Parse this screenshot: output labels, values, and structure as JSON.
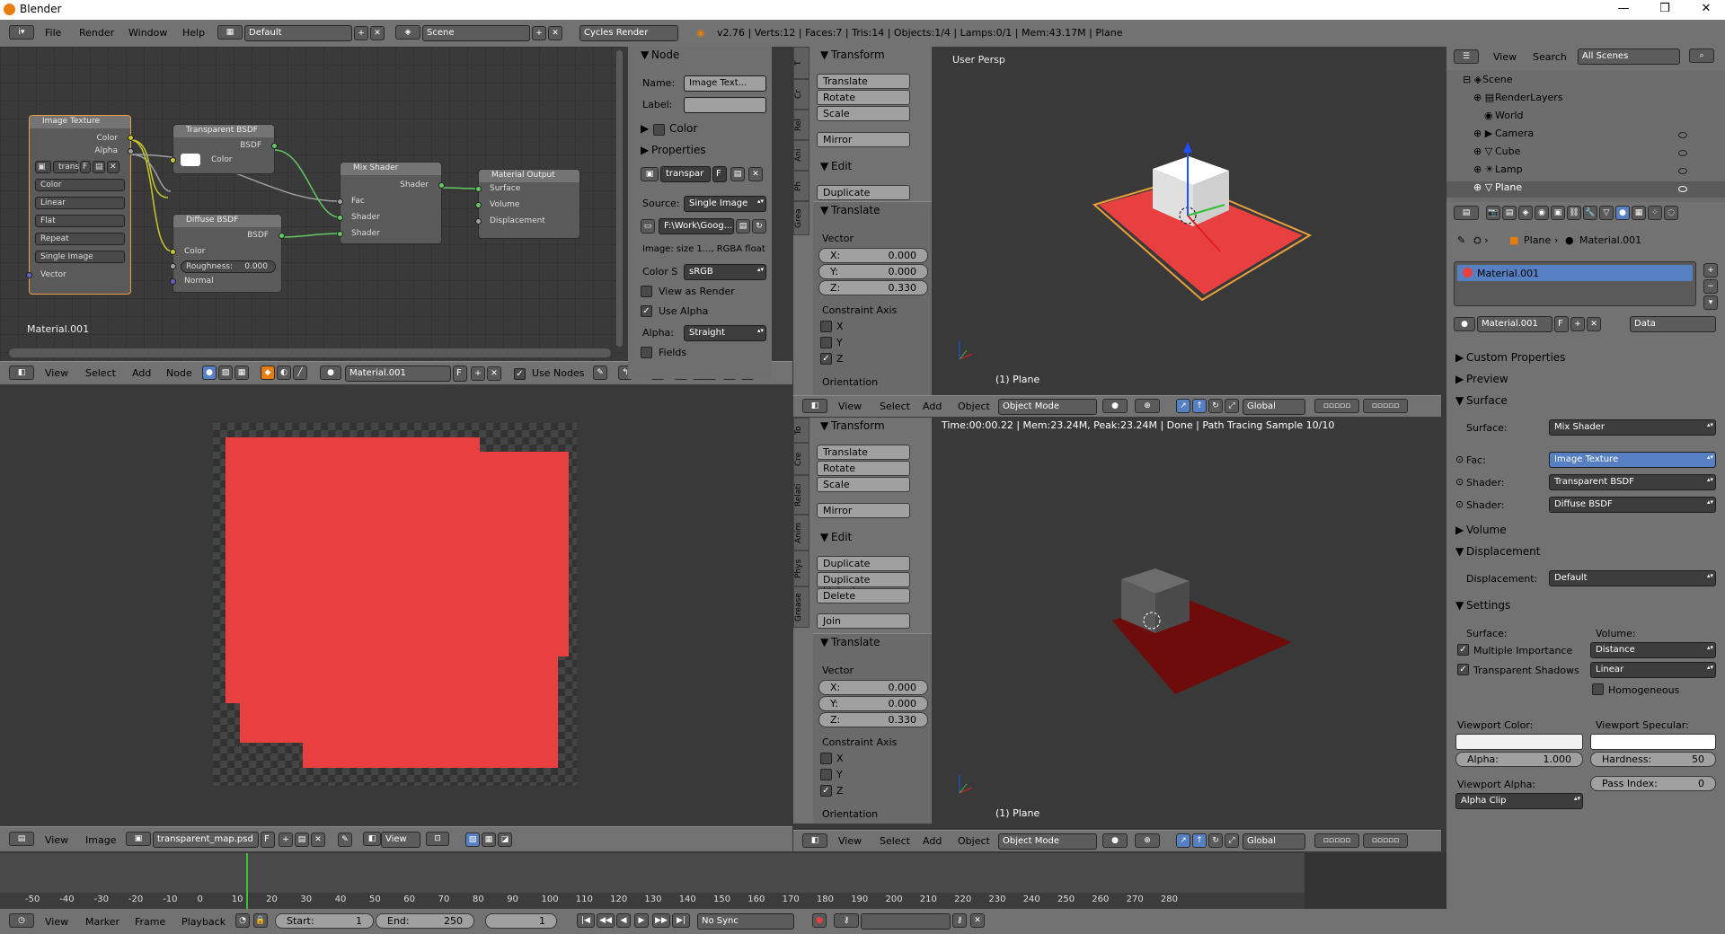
{
  "app": {
    "title": "Blender",
    "window_buttons": [
      "—",
      "❒",
      "✕"
    ]
  },
  "info_bar": {
    "menus": [
      "File",
      "Render",
      "Window",
      "Help"
    ],
    "layout": "Default",
    "scene": "Scene",
    "engine": "Cycles Render",
    "stats": "v2.76 | Verts:12 | Faces:7 | Tris:14 | Objects:1/4 | Lamps:0/1 | Mem:43.17M | Plane"
  },
  "node_editor": {
    "material_label": "Material.001",
    "nodes": {
      "image_texture": {
        "title": "Image Texture",
        "out_color": "Color",
        "out_alpha": "Alpha",
        "image": "trans",
        "image_f": "F",
        "color": "Color",
        "interp": "Linear",
        "proj": "Flat",
        "ext": "Repeat",
        "source": "Single Image",
        "vector": "Vector"
      },
      "transparent": {
        "title": "Transparent BSDF",
        "out": "BSDF",
        "color": "Color"
      },
      "diffuse": {
        "title": "Diffuse BSDF",
        "out": "BSDF",
        "color": "Color",
        "roughness": "Roughness:",
        "roughness_val": "0.000",
        "normal": "Normal"
      },
      "mix": {
        "title": "Mix Shader",
        "out": "Shader",
        "fac": "Fac",
        "shader1": "Shader",
        "shader2": "Shader"
      },
      "output": {
        "title": "Material Output",
        "surface": "Surface",
        "volume": "Volume",
        "displacement": "Displacement"
      }
    },
    "header": {
      "menus": [
        "View",
        "Select",
        "Add",
        "Node"
      ],
      "material": "Material.001",
      "f": "F",
      "use_nodes": "Use Nodes"
    }
  },
  "node_panel": {
    "node_title": "Node",
    "name_label": "Name:",
    "name_value": "Image Text...",
    "label_label": "Label:",
    "label_value": "",
    "color_title": "Color",
    "properties_title": "Properties",
    "img_name": "transpar",
    "img_f": "F",
    "source_label": "Source:",
    "source_value": "Single Image",
    "path": "F:\\Work\\Goog...",
    "image_info": "Image: size 1..., RGBA float",
    "colors_label": "Color S",
    "colors_value": "sRGB",
    "view_as_render": "View as Render",
    "use_alpha": "Use Alpha",
    "alpha_label": "Alpha:",
    "alpha_value": "Straight",
    "fields": "Fields"
  },
  "image_editor": {
    "header": {
      "menus": [
        "View",
        "Image"
      ],
      "image": "transparent_map.psd",
      "f": "F",
      "view": "View"
    }
  },
  "tools": {
    "tabs1": [
      "T",
      "Cr",
      "Rel",
      "Ani",
      "Ph",
      "Grea"
    ],
    "tabs2": [
      "To",
      "Cre",
      "Relati",
      "Anim",
      "Phys",
      "Grease"
    ],
    "transform": "Transform",
    "translate": "Translate",
    "rotate": "Rotate",
    "scale": "Scale",
    "mirror": "Mirror",
    "edit": "Edit",
    "duplicate": "Duplicate",
    "duplicate_linked": "Duplicate Linked",
    "delete": "Delete",
    "join": "Join",
    "op_title": "Translate",
    "vector": "Vector",
    "x_label": "X:",
    "x_val": "0.000",
    "y_label": "Y:",
    "y_val": "0.000",
    "z_label": "Z:",
    "z_val": "0.330",
    "constraint": "Constraint Axis",
    "cx": "X",
    "cy": "Y",
    "cz": "Z",
    "orientation": "Orientation"
  },
  "viewport1": {
    "label": "User Persp",
    "object": "(1) Plane",
    "header": {
      "menus": [
        "View",
        "Select",
        "Add",
        "Object"
      ],
      "mode": "Object Mode",
      "orientation": "Global"
    }
  },
  "viewport2": {
    "status": "Time:00:00.22 | Mem:23.24M, Peak:23.24M | Done | Path Tracing Sample 10/10",
    "object": "(1) Plane",
    "header": {
      "menus": [
        "View",
        "Select",
        "Add",
        "Object"
      ],
      "mode": "Object Mode",
      "orientation": "Global"
    }
  },
  "outliner": {
    "menus": [
      "View",
      "Search"
    ],
    "filter": "All Scenes",
    "items": [
      "Scene",
      "RenderLayers",
      "World",
      "Camera",
      "Cube",
      "Lamp",
      "Plane"
    ]
  },
  "properties": {
    "breadcrumb_object": "Plane",
    "breadcrumb_material": "Material.001",
    "slot": "Material.001",
    "material_field": "Material.001",
    "f": "F",
    "link": "Data",
    "custom_props": "Custom Properties",
    "preview": "Preview",
    "surface_title": "Surface",
    "surface_label": "Surface:",
    "surface_value": "Mix Shader",
    "fac_label": "Fac:",
    "fac_value": "Image Texture",
    "shader_label": "Shader:",
    "shader1": "Transparent BSDF",
    "shader2": "Diffuse BSDF",
    "volume": "Volume",
    "displacement": "Displacement",
    "disp_label": "Displacement:",
    "disp_value": "Default",
    "settings": "Settings",
    "set_surface": "Surface:",
    "set_volume": "Volume:",
    "mult_imp": "Multiple Importance",
    "trans_shadows": "Transparent Shadows",
    "vol_sampling": "Distance",
    "vol_interp": "Linear",
    "homogeneous": "Homogeneous",
    "vp_color": "Viewport Color:",
    "vp_spec": "Viewport Specular:",
    "alpha_label": "Alpha:",
    "alpha_val": "1.000",
    "hard_label": "Hardness:",
    "hard_val": "50",
    "vp_alpha": "Viewport Alpha:",
    "pass_label": "Pass Index:",
    "pass_val": "0",
    "alpha_clip": "Alpha Clip"
  },
  "timeline": {
    "ticks": [
      "-50",
      "-40",
      "-30",
      "-20",
      "-10",
      "0",
      "10",
      "20",
      "30",
      "40",
      "50",
      "60",
      "70",
      "80",
      "90",
      "100",
      "110",
      "120",
      "130",
      "140",
      "150",
      "160",
      "170",
      "180",
      "190",
      "200",
      "210",
      "220",
      "230",
      "240",
      "250",
      "260",
      "270",
      "280"
    ],
    "menus": [
      "View",
      "Marker",
      "Frame",
      "Playback"
    ],
    "start_label": "Start:",
    "start": "1",
    "end_label": "End:",
    "end": "250",
    "current": "1",
    "sync": "No Sync"
  },
  "colors": {
    "accent": "#e87d0d",
    "red": "#e84040",
    "selected": "#5680c2"
  }
}
